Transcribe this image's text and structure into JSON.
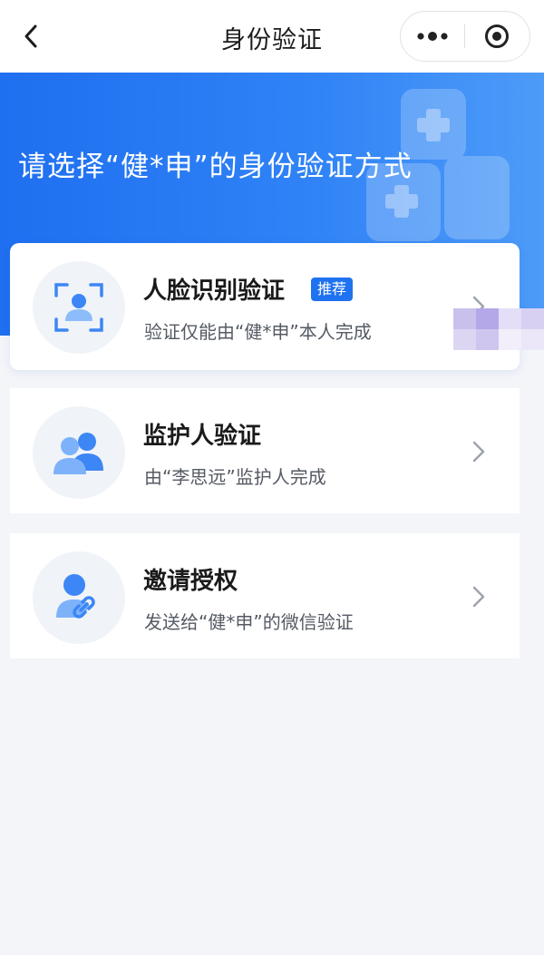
{
  "navbar": {
    "title": "身份验证",
    "back_icon": "chevron-left-icon",
    "more_icon": "more-dots-icon",
    "close_icon": "target-close-icon"
  },
  "banner": {
    "title": "请选择“健*申”的身份验证方式",
    "colors": {
      "start": "#1f6ff0",
      "end": "#4d9bf8"
    }
  },
  "options": [
    {
      "title": "人脸识别验证",
      "badge": "推荐",
      "desc": "验证仅能由“健*申”本人完成",
      "icon": "face-scan-icon"
    },
    {
      "title": "监护人验证",
      "desc": "由“李思远”监护人完成",
      "icon": "guardian-users-icon"
    },
    {
      "title": "邀请授权",
      "desc": "发送给“健*申”的微信验证",
      "icon": "invite-link-icon"
    }
  ],
  "colors": {
    "accent": "#1f72f0",
    "background": "#f3f5f9",
    "icon_blue": "#3c86f5"
  }
}
